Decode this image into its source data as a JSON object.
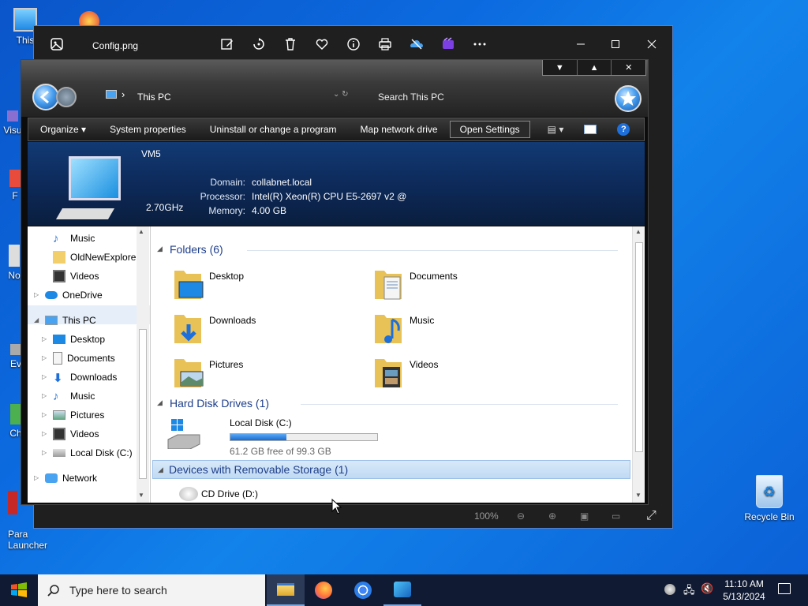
{
  "desktop": {
    "icons_left": [
      {
        "label": "This"
      },
      {
        "label": "Visu"
      },
      {
        "label": "F"
      },
      {
        "label": "No"
      },
      {
        "label": "Ev"
      },
      {
        "label": "Ch"
      },
      {
        "label": "Para\nLauncher"
      }
    ],
    "recycle_bin": "Recycle Bin"
  },
  "photos": {
    "title": "Config.png",
    "zoom": "100%",
    "toolbar_icons": [
      "edit-icon",
      "rotate-icon",
      "delete-icon",
      "favorite-icon",
      "info-icon",
      "print-icon",
      "onedrive-icon",
      "clipchamp-icon",
      "more-icon"
    ]
  },
  "explorer": {
    "address": "This PC",
    "search_placeholder": "Search This PC",
    "commands": [
      "Organize",
      "System properties",
      "Uninstall or change a program",
      "Map network drive",
      "Open Settings"
    ],
    "computer": {
      "name": "VM5",
      "domain_label": "Domain:",
      "domain": "collabnet.local",
      "processor_label": "Processor:",
      "processor": "Intel(R) Xeon(R) CPU E5-2697 v2 @ 2.70GHz",
      "memory_label": "Memory:",
      "memory": "4.00 GB"
    },
    "nav": {
      "music": "Music",
      "oldnew": "OldNewExplorer",
      "videos": "Videos",
      "onedrive": "OneDrive",
      "thispc": "This PC",
      "desktop": "Desktop",
      "documents": "Documents",
      "downloads": "Downloads",
      "music2": "Music",
      "pictures": "Pictures",
      "videos2": "Videos",
      "localdisk": "Local Disk (C:)",
      "network": "Network"
    },
    "groups": {
      "folders": "Folders (6)",
      "hdd": "Hard Disk Drives (1)",
      "removable": "Devices with Removable Storage (1)"
    },
    "folders": [
      "Desktop",
      "Documents",
      "Downloads",
      "Music",
      "Pictures",
      "Videos"
    ],
    "drive": {
      "name": "Local Disk (C:)",
      "free": "61.2 GB free of 99.3 GB",
      "used_fraction": 0.384
    },
    "cd_drive": "CD Drive (D:)"
  },
  "taskbar": {
    "search_placeholder": "Type here to search",
    "time": "11:10 AM",
    "date": "5/13/2024"
  },
  "colors": {
    "accent": "#1e3e8a",
    "drive_bar": "#1a7ae0",
    "desktop_bg": "#0c6be0"
  }
}
